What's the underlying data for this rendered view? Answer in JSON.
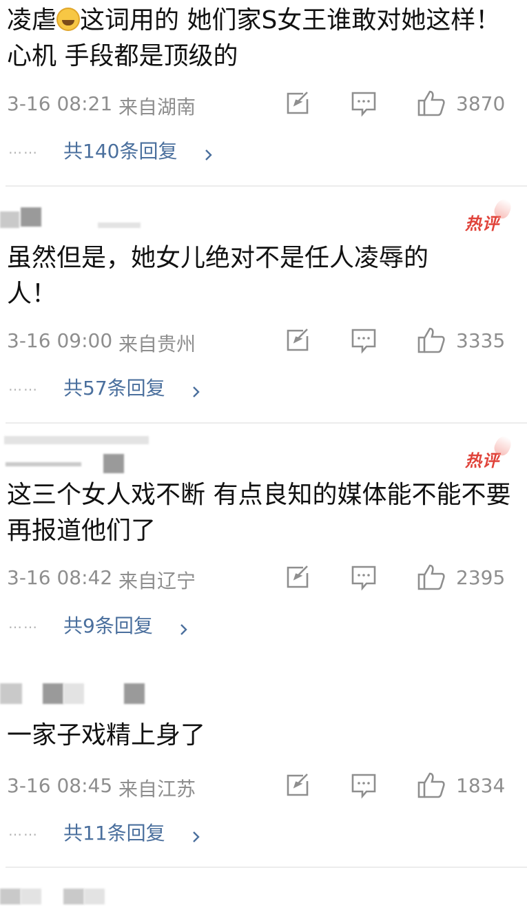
{
  "comments": [
    {
      "content_part1": "凌虐",
      "content_emoji": "laughing-crying-emoji",
      "content_part2": "这词用的  她们家S女王谁敢对她这样！  心机 手段都是顶级的",
      "time": "3-16 08:21",
      "location": "来自湖南",
      "likes": "3870",
      "replies_dots": "……",
      "replies": "共140条回复",
      "hot": false
    },
    {
      "hot_label": "热评",
      "hot": true,
      "content": "虽然但是，她女儿绝对不是任人凌辱的人！",
      "time": "3-16 09:00",
      "location": "来自贵州",
      "likes": "3335",
      "replies_dots": "……",
      "replies": "共57条回复"
    },
    {
      "hot_label": "热评",
      "hot": true,
      "content": "这三个女人戏不断 有点良知的媒体能不能不要再报道他们了",
      "time": "3-16 08:42",
      "location": "来自辽宁",
      "likes": "2395",
      "replies_dots": "……",
      "replies": "共9条回复"
    },
    {
      "hot": false,
      "content": "一家子戏精上身了",
      "time": "3-16 08:45",
      "location": "来自江苏",
      "likes": "1834",
      "replies_dots": "……",
      "replies": "共11条回复"
    }
  ],
  "icons": {
    "share": "share-icon",
    "comment": "comment-icon",
    "like": "like-icon",
    "chevron": "chevron-right-icon"
  },
  "colors": {
    "meta_text": "#8e8e8e",
    "reply_link": "#4a6f9d",
    "hot_badge": "#e0433a",
    "divider": "#ececec"
  }
}
